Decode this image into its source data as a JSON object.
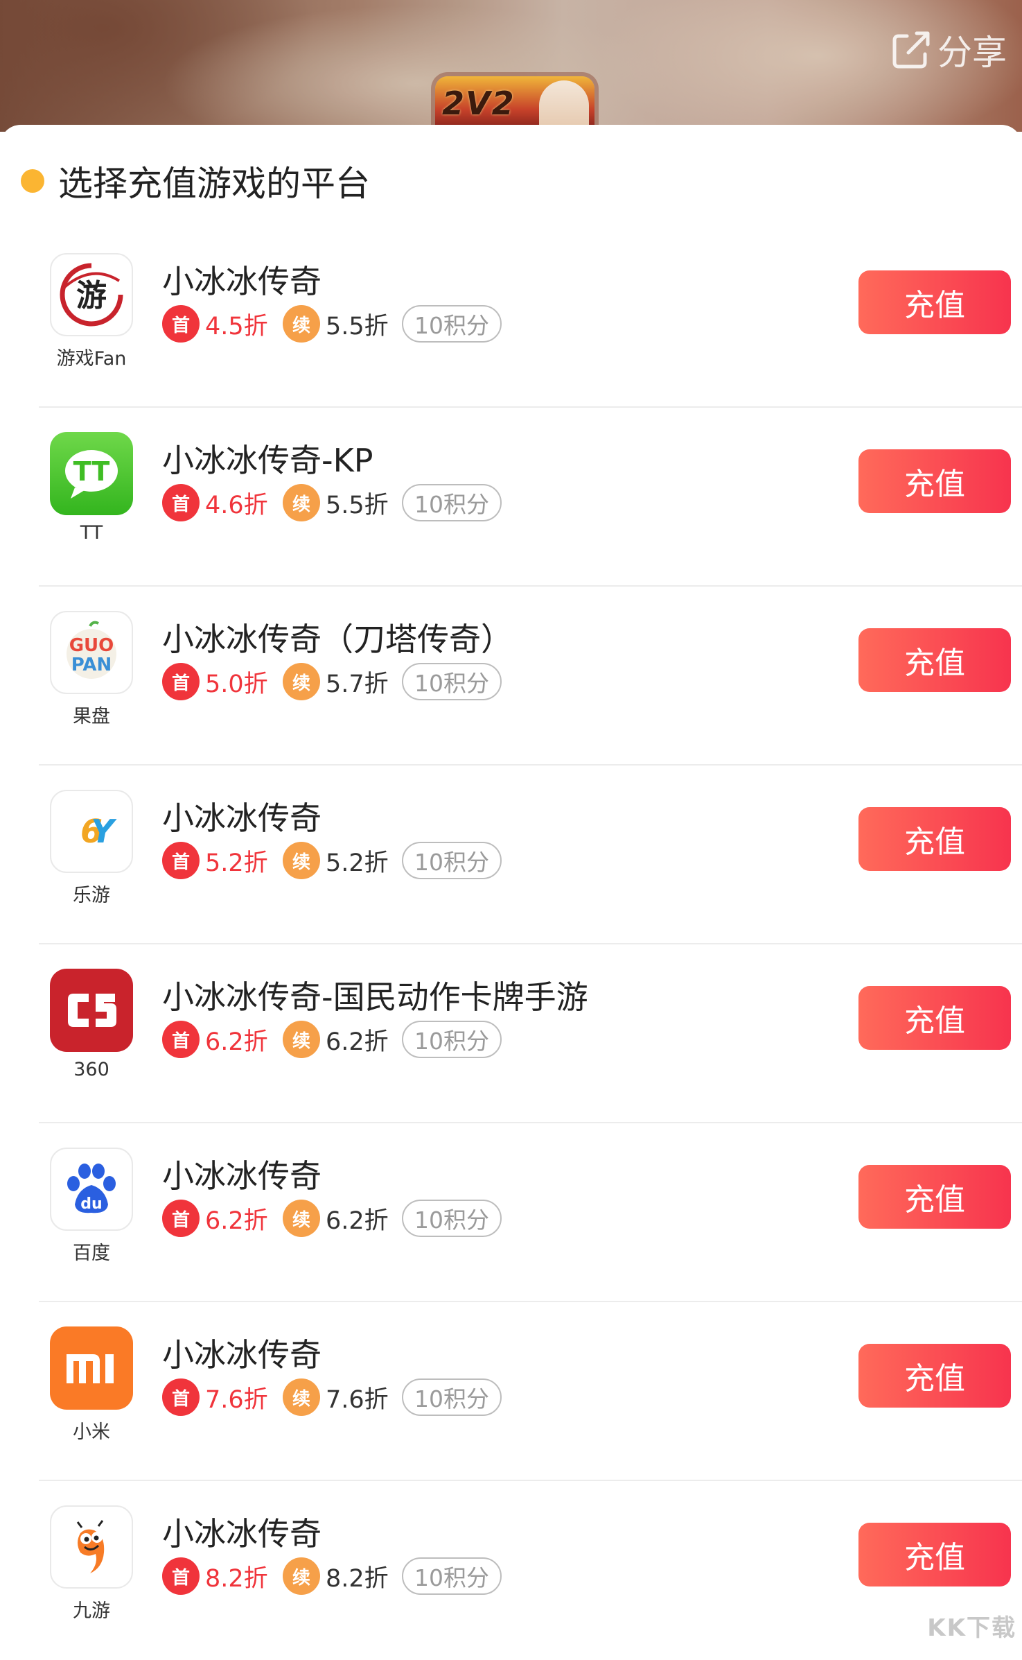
{
  "header": {
    "game_logo_text": "2V2",
    "share_label": "分享"
  },
  "sheet": {
    "title": "选择充值游戏的平台",
    "accent_color": "#fbb532"
  },
  "badges": {
    "first": "首",
    "renew": "续"
  },
  "platforms": [
    {
      "platform": "游戏Fan",
      "icon": "youxifan-icon",
      "game": "小冰冰传奇",
      "first_discount": "4.5折",
      "renew_discount": "5.5折",
      "points": "10积分",
      "button": "充值"
    },
    {
      "platform": "TT",
      "icon": "tt-icon",
      "game": "小冰冰传奇-KP",
      "first_discount": "4.6折",
      "renew_discount": "5.5折",
      "points": "10积分",
      "button": "充值"
    },
    {
      "platform": "果盘",
      "icon": "guopan-icon",
      "game": "小冰冰传奇（刀塔传奇）",
      "first_discount": "5.0折",
      "renew_discount": "5.7折",
      "points": "10积分",
      "button": "充值"
    },
    {
      "platform": "乐游",
      "icon": "6y-icon",
      "game": "小冰冰传奇",
      "first_discount": "5.2折",
      "renew_discount": "5.2折",
      "points": "10积分",
      "button": "充值"
    },
    {
      "platform": "360",
      "icon": "c5-icon",
      "game": "小冰冰传奇-国民动作卡牌手游",
      "first_discount": "6.2折",
      "renew_discount": "6.2折",
      "points": "10积分",
      "button": "充值"
    },
    {
      "platform": "百度",
      "icon": "baidu-icon",
      "game": "小冰冰传奇",
      "first_discount": "6.2折",
      "renew_discount": "6.2折",
      "points": "10积分",
      "button": "充值"
    },
    {
      "platform": "小米",
      "icon": "xiaomi-icon",
      "game": "小冰冰传奇",
      "first_discount": "7.6折",
      "renew_discount": "7.6折",
      "points": "10积分",
      "button": "充值"
    },
    {
      "platform": "九游",
      "icon": "jiuyou-icon",
      "game": "小冰冰传奇",
      "first_discount": "8.2折",
      "renew_discount": "8.2折",
      "points": "10积分",
      "button": "充值"
    }
  ],
  "watermark": "KK下载"
}
